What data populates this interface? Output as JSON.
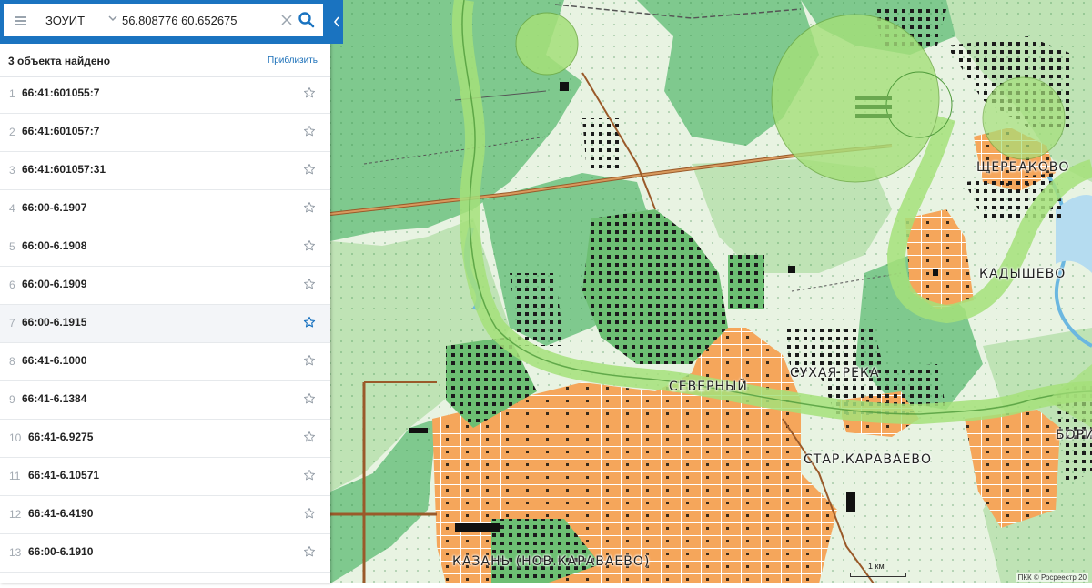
{
  "search": {
    "layer_label": "ЗОУИТ",
    "query": "56.808776 60.652675"
  },
  "results": {
    "count_label": "3 объекта найдено",
    "zoom_label": "Приблизить",
    "items": [
      {
        "num": "1",
        "id": "66:41:601055:7",
        "active": false
      },
      {
        "num": "2",
        "id": "66:41:601057:7",
        "active": false
      },
      {
        "num": "3",
        "id": "66:41:601057:31",
        "active": false
      },
      {
        "num": "4",
        "id": "66:00-6.1907",
        "active": false
      },
      {
        "num": "5",
        "id": "66:00-6.1908",
        "active": false
      },
      {
        "num": "6",
        "id": "66:00-6.1909",
        "active": false
      },
      {
        "num": "7",
        "id": "66:00-6.1915",
        "active": true
      },
      {
        "num": "8",
        "id": "66:41-6.1000",
        "active": false
      },
      {
        "num": "9",
        "id": "66:41-6.1384",
        "active": false
      },
      {
        "num": "10",
        "id": "66:41-6.9275",
        "active": false
      },
      {
        "num": "11",
        "id": "66:41-6.10571",
        "active": false
      },
      {
        "num": "12",
        "id": "66:41-6.4190",
        "active": false
      },
      {
        "num": "13",
        "id": "66:00-6.1910",
        "active": false
      }
    ]
  },
  "map": {
    "labels": {
      "shcherbakovo": "ЩЕРБАКОВО",
      "kadyshevo": "КАДЫШЕВО",
      "severny": "СЕВЕРНЫЙ",
      "sukhaya_reka": "СУХАЯ РЕКА",
      "star_karavaevo": "СТАР.КАРАВАЕВО",
      "boriso": "БОРИСО",
      "kazan": "КАЗАНЬ (НОВ.КАРАВАЕВО)"
    },
    "scale_label": "1 км",
    "attribution": "ПКК © Росреестр 20"
  },
  "colors": {
    "brand_blue": "#1a73c0",
    "forest_green": "#7fc98e",
    "zone_green": "#a5e07a",
    "urban_orange": "#f5a65b",
    "road_brown": "#9a5a2a",
    "water_blue": "#b5dcf0",
    "active_star": "#1a73c0",
    "star_grey": "#8f98a2"
  }
}
